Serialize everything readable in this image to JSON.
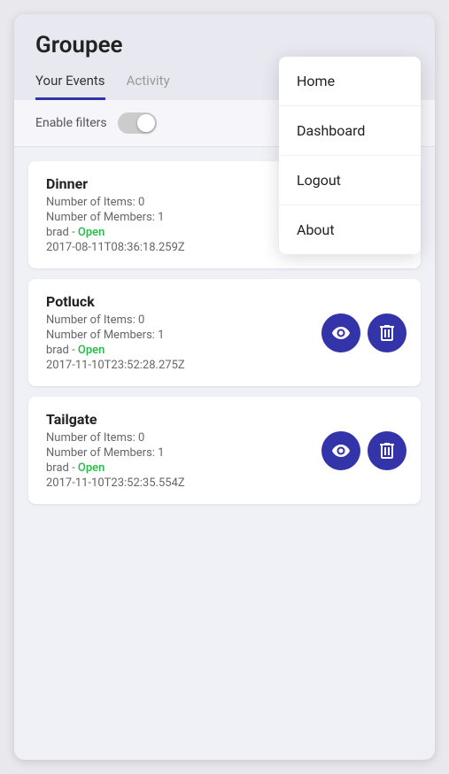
{
  "app": {
    "title": "Groupee"
  },
  "tabs": [
    {
      "id": "your-events",
      "label": "Your Events",
      "active": true
    },
    {
      "id": "activity",
      "label": "Activity",
      "active": false
    }
  ],
  "filters": {
    "label": "Enable filters",
    "enabled": false
  },
  "dropdown": {
    "items": [
      {
        "id": "home",
        "label": "Home"
      },
      {
        "id": "dashboard",
        "label": "Dashboard"
      },
      {
        "id": "logout",
        "label": "Logout"
      },
      {
        "id": "about",
        "label": "About"
      }
    ]
  },
  "events": [
    {
      "id": "dinner",
      "name": "Dinner",
      "items_count": "Number of Items: 0",
      "members_count": "Number of Members: 1",
      "owner": "brad",
      "status": "Open",
      "timestamp": "2017-08-11T08:36:18.259Z"
    },
    {
      "id": "potluck",
      "name": "Potluck",
      "items_count": "Number of Items: 0",
      "members_count": "Number of Members: 1",
      "owner": "brad",
      "status": "Open",
      "timestamp": "2017-11-10T23:52:28.275Z"
    },
    {
      "id": "tailgate",
      "name": "Tailgate",
      "items_count": "Number of Items: 0",
      "members_count": "Number of Members: 1",
      "owner": "brad",
      "status": "Open",
      "timestamp": "2017-11-10T23:52:35.554Z"
    }
  ],
  "colors": {
    "accent": "#3333aa",
    "open_status": "#22bb44"
  }
}
